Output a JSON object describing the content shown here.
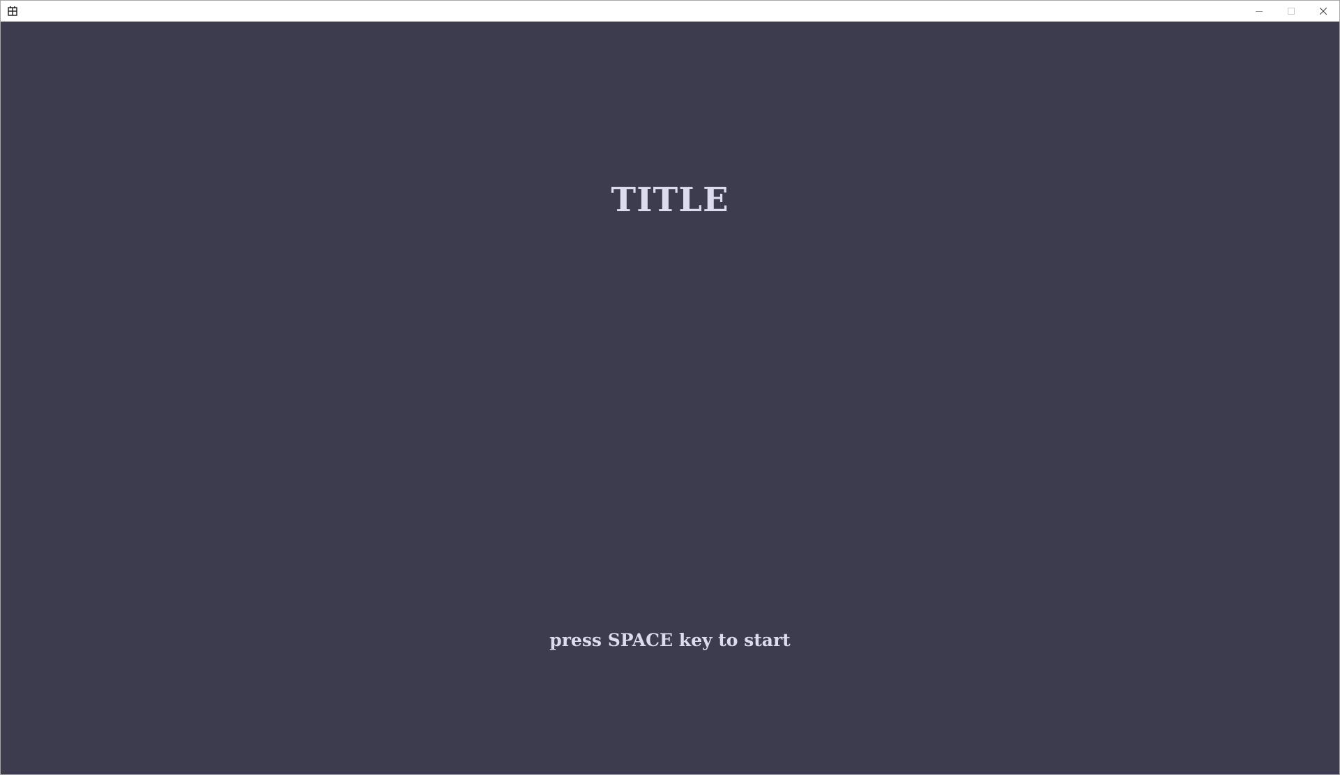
{
  "window": {
    "icon": "app-window-icon",
    "controls": {
      "minimize_icon": "minimize-icon",
      "maximize_icon": "maximize-icon",
      "close_icon": "close-icon"
    }
  },
  "game": {
    "title": "TITLE",
    "prompt": "press SPACE key to start",
    "background_color": "#3c3c4e",
    "text_color": "#dcdcee"
  }
}
